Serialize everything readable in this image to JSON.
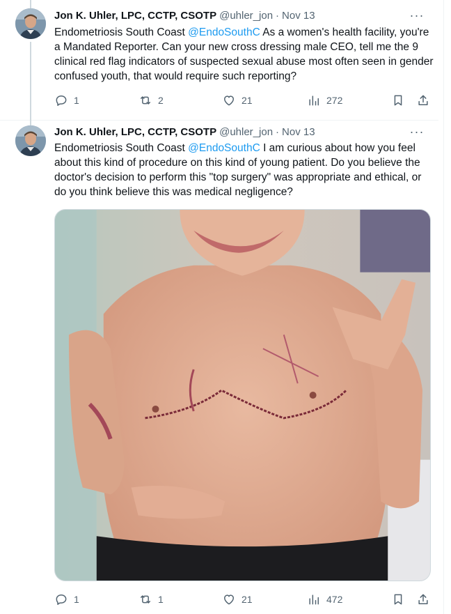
{
  "tweets": [
    {
      "author_name": "Jon K. Uhler, LPC, CCTP, CSOTP",
      "handle": "@uhler_jon",
      "separator": "·",
      "timestamp": "Nov 13",
      "text_prefix": "Endometriosis South Coast ",
      "mention": "@EndoSouthC",
      "text_suffix": " As a women's health facility, you're a Mandated Reporter. Can your new cross dressing male CEO, tell me the 9 clinical red flag indicators of suspected sexual abuse most often seen in gender confused youth, that would require such reporting?",
      "replies": "1",
      "reposts": "2",
      "likes": "21",
      "views": "272"
    },
    {
      "author_name": "Jon K. Uhler, LPC, CCTP, CSOTP",
      "handle": "@uhler_jon",
      "separator": "·",
      "timestamp": "Nov 13",
      "text_prefix": "Endometriosis South Coast ",
      "mention": "@EndoSouthC",
      "text_suffix": "  I am curious about how you feel about this kind of procedure on this kind of young patient. Do you believe the doctor's decision to perform this \"top surgery\" was appropriate and ethical, or do you think believe this was medical negligence?",
      "replies": "1",
      "reposts": "1",
      "likes": "21",
      "views": "472"
    }
  ],
  "icons": {
    "more": "more-horizontal-icon",
    "reply": "reply-icon",
    "repost": "repost-icon",
    "like": "heart-icon",
    "views": "views-bar-icon",
    "bookmark": "bookmark-icon",
    "share": "share-icon"
  },
  "colors": {
    "text": "#0f1419",
    "secondary": "#536471",
    "link": "#1d9bf0",
    "thread_line": "#cfd9de"
  }
}
